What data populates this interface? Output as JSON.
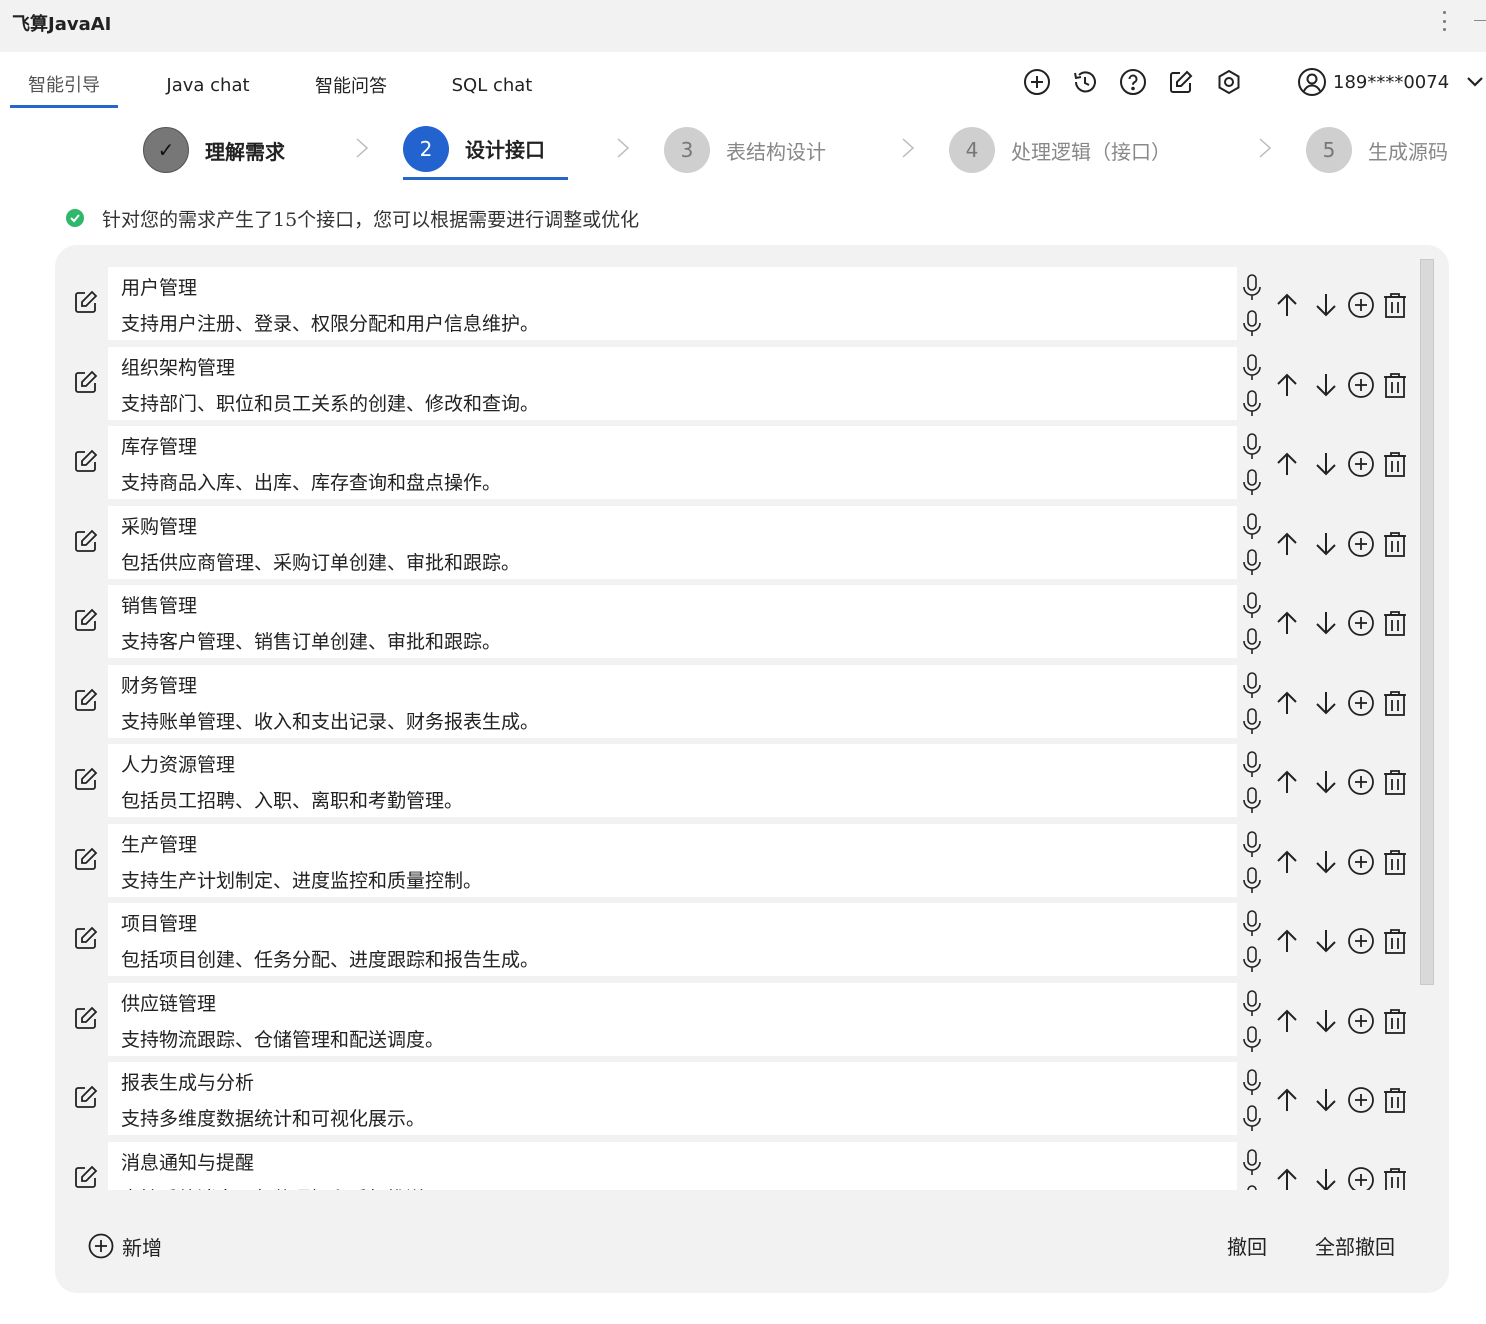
{
  "window": {
    "title": "飞算JavaAI"
  },
  "tabs": [
    {
      "label": "智能引导",
      "active": true
    },
    {
      "label": "Java chat",
      "active": false
    },
    {
      "label": "智能问答",
      "active": false
    },
    {
      "label": "SQL chat",
      "active": false
    }
  ],
  "header_icons": [
    "plus-circle-icon",
    "history-icon",
    "help-icon",
    "edit-icon",
    "settings-icon"
  ],
  "account": {
    "phone": "189****0074"
  },
  "steps": [
    {
      "number": "✓",
      "label": "理解需求",
      "state": "done"
    },
    {
      "number": "2",
      "label": "设计接口",
      "state": "current"
    },
    {
      "number": "3",
      "label": "表结构设计",
      "state": "pending"
    },
    {
      "number": "4",
      "label": "处理逻辑（接口）",
      "state": "pending"
    },
    {
      "number": "5",
      "label": "生成源码",
      "state": "pending"
    }
  ],
  "info": {
    "text": "针对您的需求产生了15个接口，您可以根据需要进行调整或优化"
  },
  "interfaces": [
    {
      "title": "用户管理",
      "desc": "支持用户注册、登录、权限分配和用户信息维护。"
    },
    {
      "title": "组织架构管理",
      "desc": "支持部门、职位和员工关系的创建、修改和查询。"
    },
    {
      "title": "库存管理",
      "desc": "支持商品入库、出库、库存查询和盘点操作。"
    },
    {
      "title": "采购管理",
      "desc": "包括供应商管理、采购订单创建、审批和跟踪。"
    },
    {
      "title": "销售管理",
      "desc": "支持客户管理、销售订单创建、审批和跟踪。"
    },
    {
      "title": "财务管理",
      "desc": "支持账单管理、收入和支出记录、财务报表生成。"
    },
    {
      "title": "人力资源管理",
      "desc": "包括员工招聘、入职、离职和考勤管理。"
    },
    {
      "title": "生产管理",
      "desc": "支持生产计划制定、进度监控和质量控制。"
    },
    {
      "title": "项目管理",
      "desc": "包括项目创建、任务分配、进度跟踪和报告生成。"
    },
    {
      "title": "供应链管理",
      "desc": "支持物流跟踪、仓储管理和配送调度。"
    },
    {
      "title": "报表生成与分析",
      "desc": "支持多维度数据统计和可视化展示。"
    },
    {
      "title": "消息通知与提醒",
      "desc": "支持系统消息、邮件通知和手机推送。"
    }
  ],
  "footer": {
    "add_label": "新增",
    "undo_label": "撤回",
    "undo_all_label": "全部撤回"
  },
  "colors": {
    "accent": "#2566c9",
    "success": "#2db86b",
    "panel": "#f2f2f2"
  }
}
